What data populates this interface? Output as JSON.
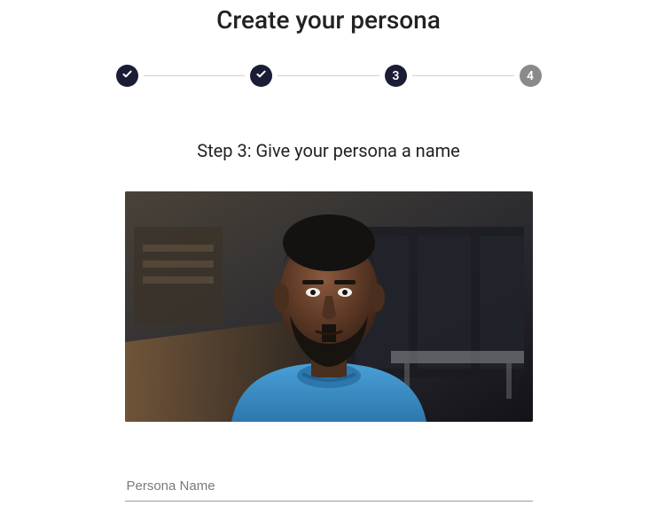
{
  "title": "Create your persona",
  "stepper": {
    "steps": [
      {
        "state": "done"
      },
      {
        "state": "done"
      },
      {
        "state": "current",
        "label": "3"
      },
      {
        "state": "pending",
        "label": "4"
      }
    ]
  },
  "step_heading": "Step 3: Give your persona a name",
  "name_field": {
    "placeholder": "Persona Name",
    "value": ""
  }
}
